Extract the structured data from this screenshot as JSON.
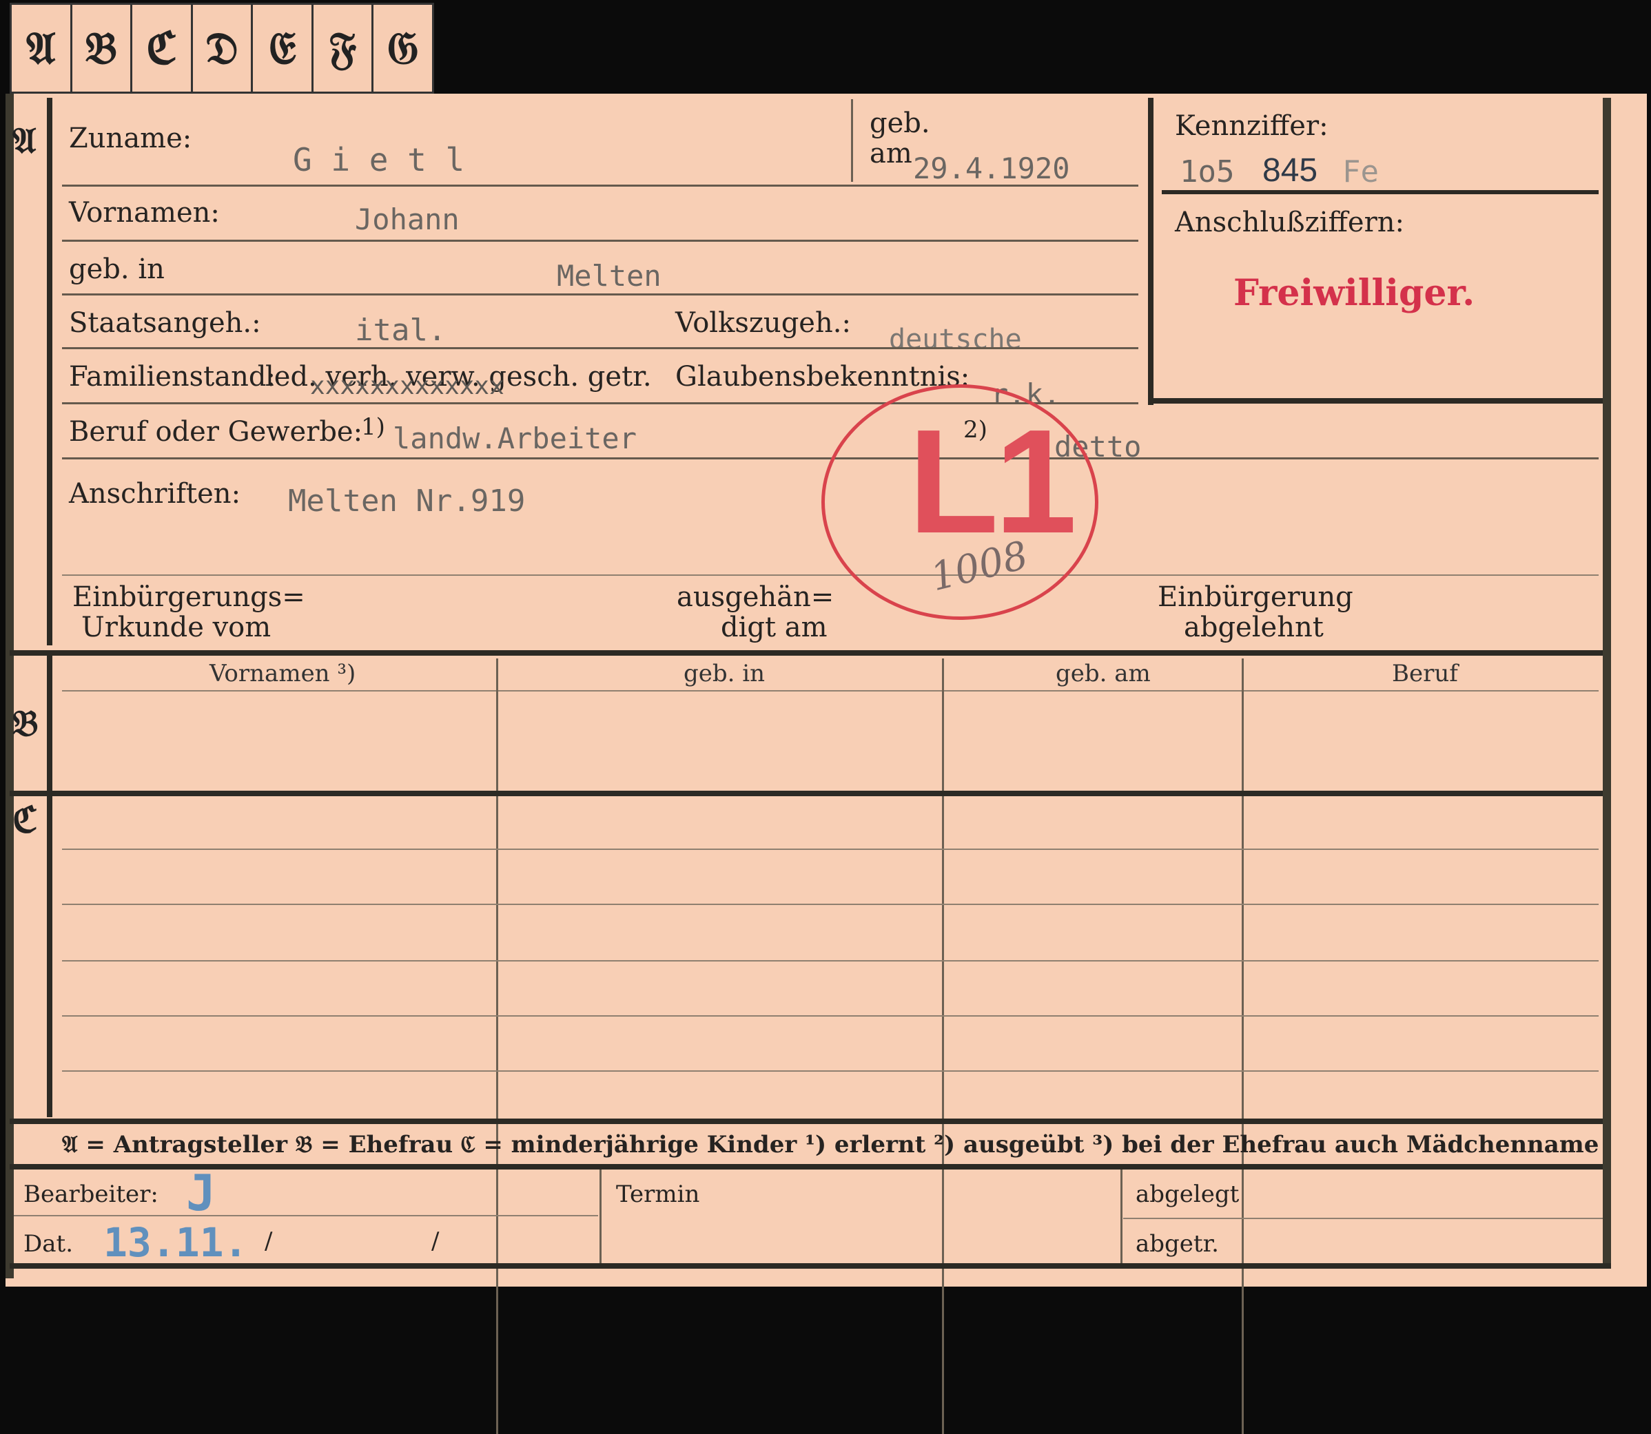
{
  "tabs": [
    "𝔄",
    "𝔅",
    "ℭ",
    "𝔇",
    "𝔈",
    "𝔉",
    "𝔊"
  ],
  "sections": {
    "a": "𝔄",
    "b": "𝔅",
    "c": "ℭ"
  },
  "a": {
    "zuname_label": "Zuname:",
    "zuname_value": "G i e t l",
    "geb_label": "geb.",
    "am_label": "am",
    "geb_am_value": "29.4.1920",
    "kennziffer_label": "Kennziffer:",
    "kennziffer_part1": "1o5",
    "kennziffer_part2": "845",
    "kennziffer_part3": "Fe",
    "anschluss_label": "Anschlußziffern:",
    "freiwilliger": "Freiwilliger.",
    "vornamen_label": "Vornamen:",
    "vornamen_value": "Johann",
    "geb_in_label": "geb. in",
    "geb_in_value": "Melten",
    "staats_label": "Staatsangeh.:",
    "staats_value": "ital.",
    "volks_label": "Volkszugeh.:",
    "volks_value": "deutsche",
    "familien_label": "Familienstand:",
    "familien_options": "led. verh. verw. gesch. getr.",
    "familien_strike": "xxxxxxxxxxxxx",
    "glauben_label": "Glaubensbekenntnis:",
    "glauben_value": "r.k.",
    "beruf_label": "Beruf oder Gewerbe:",
    "beruf_note1": "1)",
    "beruf_value": "landw.Arbeiter",
    "beruf_note2": "2)",
    "beruf_value2": "detto",
    "anschrift_label": "Anschriften:",
    "anschrift_value": "Melten Nr.919",
    "einb_urk_1": "Einbürgerungs=",
    "einb_urk_2": "Urkunde vom",
    "ausgeh_1": "ausgehän=",
    "ausgeh_2": "digt am",
    "einb_abg_1": "Einbürgerung",
    "einb_abg_2": "abgelehnt"
  },
  "stamp": {
    "text": "L1",
    "number": "1008",
    "color": "#d9434c"
  },
  "table_headers": [
    "Vornamen ³)",
    "geb. in",
    "geb. am",
    "Beruf"
  ],
  "legend": "𝔄 = Antragsteller   𝔅 = Ehefrau   ℭ = minderjährige Kinder   ¹) erlernt   ²) ausgeübt   ³) bei der Ehefrau auch Mädchenname",
  "footer": {
    "bearbeiter_label": "Bearbeiter:",
    "bearbeiter_value": "J",
    "dat_label": "Dat.",
    "dat_value": "13.11.",
    "slash1": "/",
    "slash2": "/",
    "termin_label": "Termin",
    "abgelegt_label": "abgelegt",
    "abgetr_label": "abgetr."
  }
}
